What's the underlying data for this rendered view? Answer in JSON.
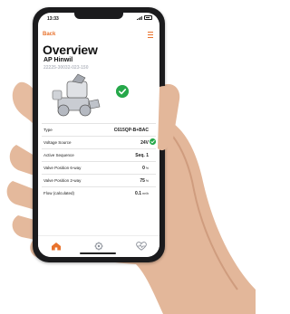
{
  "status_bar": {
    "time": "13:33"
  },
  "header": {
    "back_label": "Back"
  },
  "overview": {
    "title": "Overview",
    "device_name": "AP Hinwil",
    "serial": "22225-30032-023-150"
  },
  "rows": [
    {
      "label": "Type",
      "value": "C615QP-B+BAC",
      "unit": ""
    },
    {
      "label": "Voltage Source",
      "value": "24V",
      "unit": ""
    },
    {
      "label": "Active Sequence",
      "value": "Seq. 1",
      "unit": ""
    },
    {
      "label": "Valve Position 6-way",
      "value": "0",
      "unit": "%"
    },
    {
      "label": "Valve Position 2-way",
      "value": "75",
      "unit": "%"
    },
    {
      "label": "Flow (calculated)",
      "value": "0.1",
      "unit": "m³/h"
    }
  ],
  "tabbar": {
    "items": [
      "home-icon",
      "gear-icon",
      "heartbeat-icon"
    ]
  },
  "colors": {
    "accent": "#e8722c",
    "ok": "#26a84a",
    "text": "#111111"
  }
}
